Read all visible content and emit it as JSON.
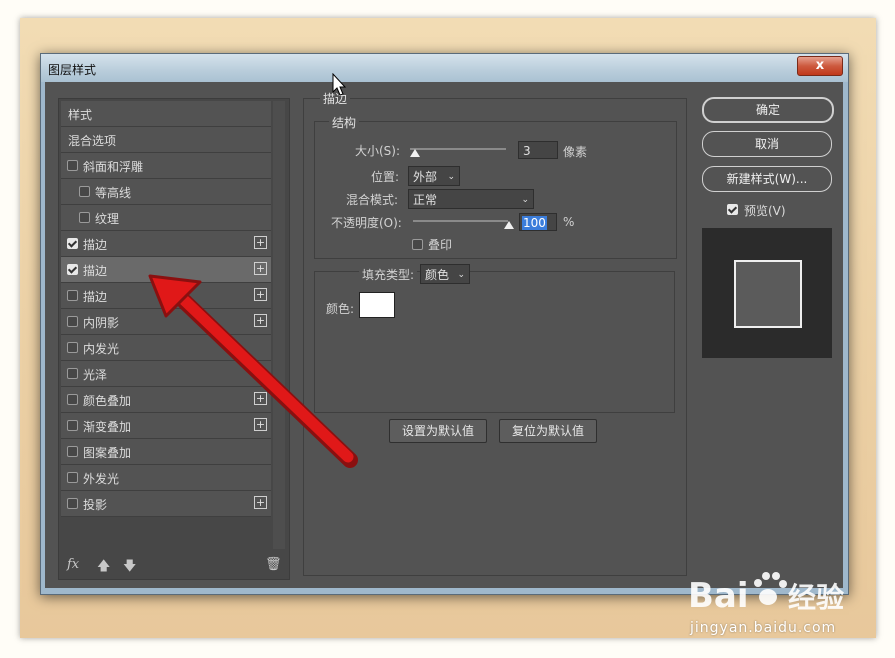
{
  "window": {
    "title": "图层样式",
    "close_label": "x"
  },
  "style_list": {
    "header": "样式",
    "items": [
      {
        "label": "混合选项",
        "checkbox": false,
        "checked": false,
        "plus": false,
        "indent": false,
        "selected": false
      },
      {
        "label": "斜面和浮雕",
        "checkbox": true,
        "checked": false,
        "plus": false,
        "indent": false,
        "selected": false
      },
      {
        "label": "等高线",
        "checkbox": true,
        "checked": false,
        "plus": false,
        "indent": true,
        "selected": false
      },
      {
        "label": "纹理",
        "checkbox": true,
        "checked": false,
        "plus": false,
        "indent": true,
        "selected": false
      },
      {
        "label": "描边",
        "checkbox": true,
        "checked": true,
        "plus": true,
        "indent": false,
        "selected": false
      },
      {
        "label": "描边",
        "checkbox": true,
        "checked": true,
        "plus": true,
        "indent": false,
        "selected": true
      },
      {
        "label": "描边",
        "checkbox": true,
        "checked": false,
        "plus": true,
        "indent": false,
        "selected": false
      },
      {
        "label": "内阴影",
        "checkbox": true,
        "checked": false,
        "plus": true,
        "indent": false,
        "selected": false
      },
      {
        "label": "内发光",
        "checkbox": true,
        "checked": false,
        "plus": false,
        "indent": false,
        "selected": false
      },
      {
        "label": "光泽",
        "checkbox": true,
        "checked": false,
        "plus": false,
        "indent": false,
        "selected": false
      },
      {
        "label": "颜色叠加",
        "checkbox": true,
        "checked": false,
        "plus": true,
        "indent": false,
        "selected": false
      },
      {
        "label": "渐变叠加",
        "checkbox": true,
        "checked": false,
        "plus": true,
        "indent": false,
        "selected": false
      },
      {
        "label": "图案叠加",
        "checkbox": true,
        "checked": false,
        "plus": false,
        "indent": false,
        "selected": false
      },
      {
        "label": "外发光",
        "checkbox": true,
        "checked": false,
        "plus": false,
        "indent": false,
        "selected": false
      },
      {
        "label": "投影",
        "checkbox": true,
        "checked": false,
        "plus": true,
        "indent": false,
        "selected": false
      }
    ],
    "bottom_icons": [
      "fx-icon",
      "arrow-up-icon",
      "arrow-down-icon",
      "trash-icon"
    ],
    "fx_label": "fx"
  },
  "stroke": {
    "section_title": "描边",
    "structure_title": "结构",
    "size_label": "大小(S):",
    "size_value": "3",
    "size_unit": "像素",
    "position_label": "位置:",
    "position_value": "外部",
    "blend_label": "混合模式:",
    "blend_value": "正常",
    "opacity_label": "不透明度(O):",
    "opacity_value": "100",
    "opacity_unit": "%",
    "overprint_label": "叠印",
    "fill_type_label": "填充类型:",
    "fill_type_value": "颜色",
    "color_label": "颜色:",
    "color_value": "#ffffff",
    "set_default": "设置为默认值",
    "reset_default": "复位为默认值"
  },
  "actions": {
    "ok": "确定",
    "cancel": "取消",
    "new_style": "新建样式(W)...",
    "preview_label": "预览(V)",
    "preview_checked": true
  },
  "watermark": {
    "brand": "Bai",
    "brand2": "经验",
    "url": "jingyan.baidu.com"
  }
}
